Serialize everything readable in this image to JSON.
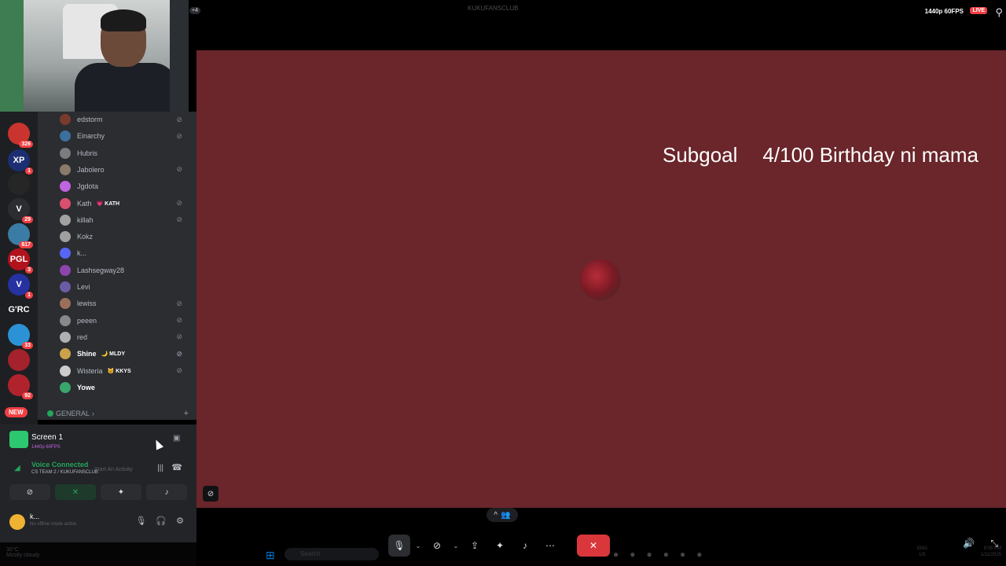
{
  "topbar": {
    "badge": "+4",
    "title": "KUKUFANSCLUB",
    "quality": "1440p 60FPS",
    "live": "LIVE",
    "person_icon": "person-icon"
  },
  "servers": [
    {
      "label": "",
      "badge": "326"
    },
    {
      "label": "XP",
      "badge": "1"
    },
    {
      "label": "",
      "badge": ""
    },
    {
      "label": "V",
      "badge": "29"
    },
    {
      "label": "",
      "badge": "617"
    },
    {
      "label": "PGL",
      "badge": "3"
    },
    {
      "label": "V",
      "badge": "1"
    },
    {
      "label": "G'RC",
      "badge": ""
    },
    {
      "label": "",
      "badge": "33"
    },
    {
      "label": "",
      "badge": ""
    },
    {
      "label": "",
      "badge": "92"
    }
  ],
  "new_badge": "NEW",
  "members": [
    {
      "name": "edstorm",
      "tag": "",
      "muted": true
    },
    {
      "name": "Einarchy",
      "tag": "",
      "muted": true
    },
    {
      "name": "Hubris",
      "tag": "",
      "muted": false
    },
    {
      "name": "Jabolero",
      "tag": "",
      "muted": true
    },
    {
      "name": "Jgdota",
      "tag": "",
      "muted": false
    },
    {
      "name": "Kath",
      "tag": "💗 KATH",
      "muted": true
    },
    {
      "name": "killah",
      "tag": "",
      "muted": true
    },
    {
      "name": "Kokz",
      "tag": "",
      "muted": false
    },
    {
      "name": "k...",
      "tag": "",
      "muted": false
    },
    {
      "name": "Lashsegway28",
      "tag": "",
      "muted": false
    },
    {
      "name": "Levi",
      "tag": "",
      "muted": false
    },
    {
      "name": "lewiss",
      "tag": "",
      "muted": true
    },
    {
      "name": "peeen",
      "tag": "",
      "muted": true
    },
    {
      "name": "red",
      "tag": "",
      "muted": true
    },
    {
      "name": "Shine",
      "tag": "🌙 MLDY",
      "muted": true
    },
    {
      "name": "Wisteria",
      "tag": "🐱 KKYS",
      "muted": true
    },
    {
      "name": "Yowe",
      "tag": "",
      "muted": false
    }
  ],
  "category": "GENERAL",
  "screen": {
    "title": "Screen 1",
    "sub": "1440p 60FPS"
  },
  "voice": {
    "status": "Voice Connected",
    "channel": "CS TEAM 2 / KUKUFANSCLUB",
    "ghost": "Start An Activity"
  },
  "user": {
    "name": "k...",
    "status": "No offline mode active"
  },
  "stage": {
    "subgoal_label": "Subgoal",
    "subgoal_value": "4/100 Birthday ni mama"
  },
  "taskbar": {
    "weather": "30°C",
    "weather_sub": "Mostly cloudy",
    "search": "Search",
    "lang": "ENG",
    "lang_sub": "US",
    "time": "9:05 PM",
    "date": "1/11/2025"
  }
}
